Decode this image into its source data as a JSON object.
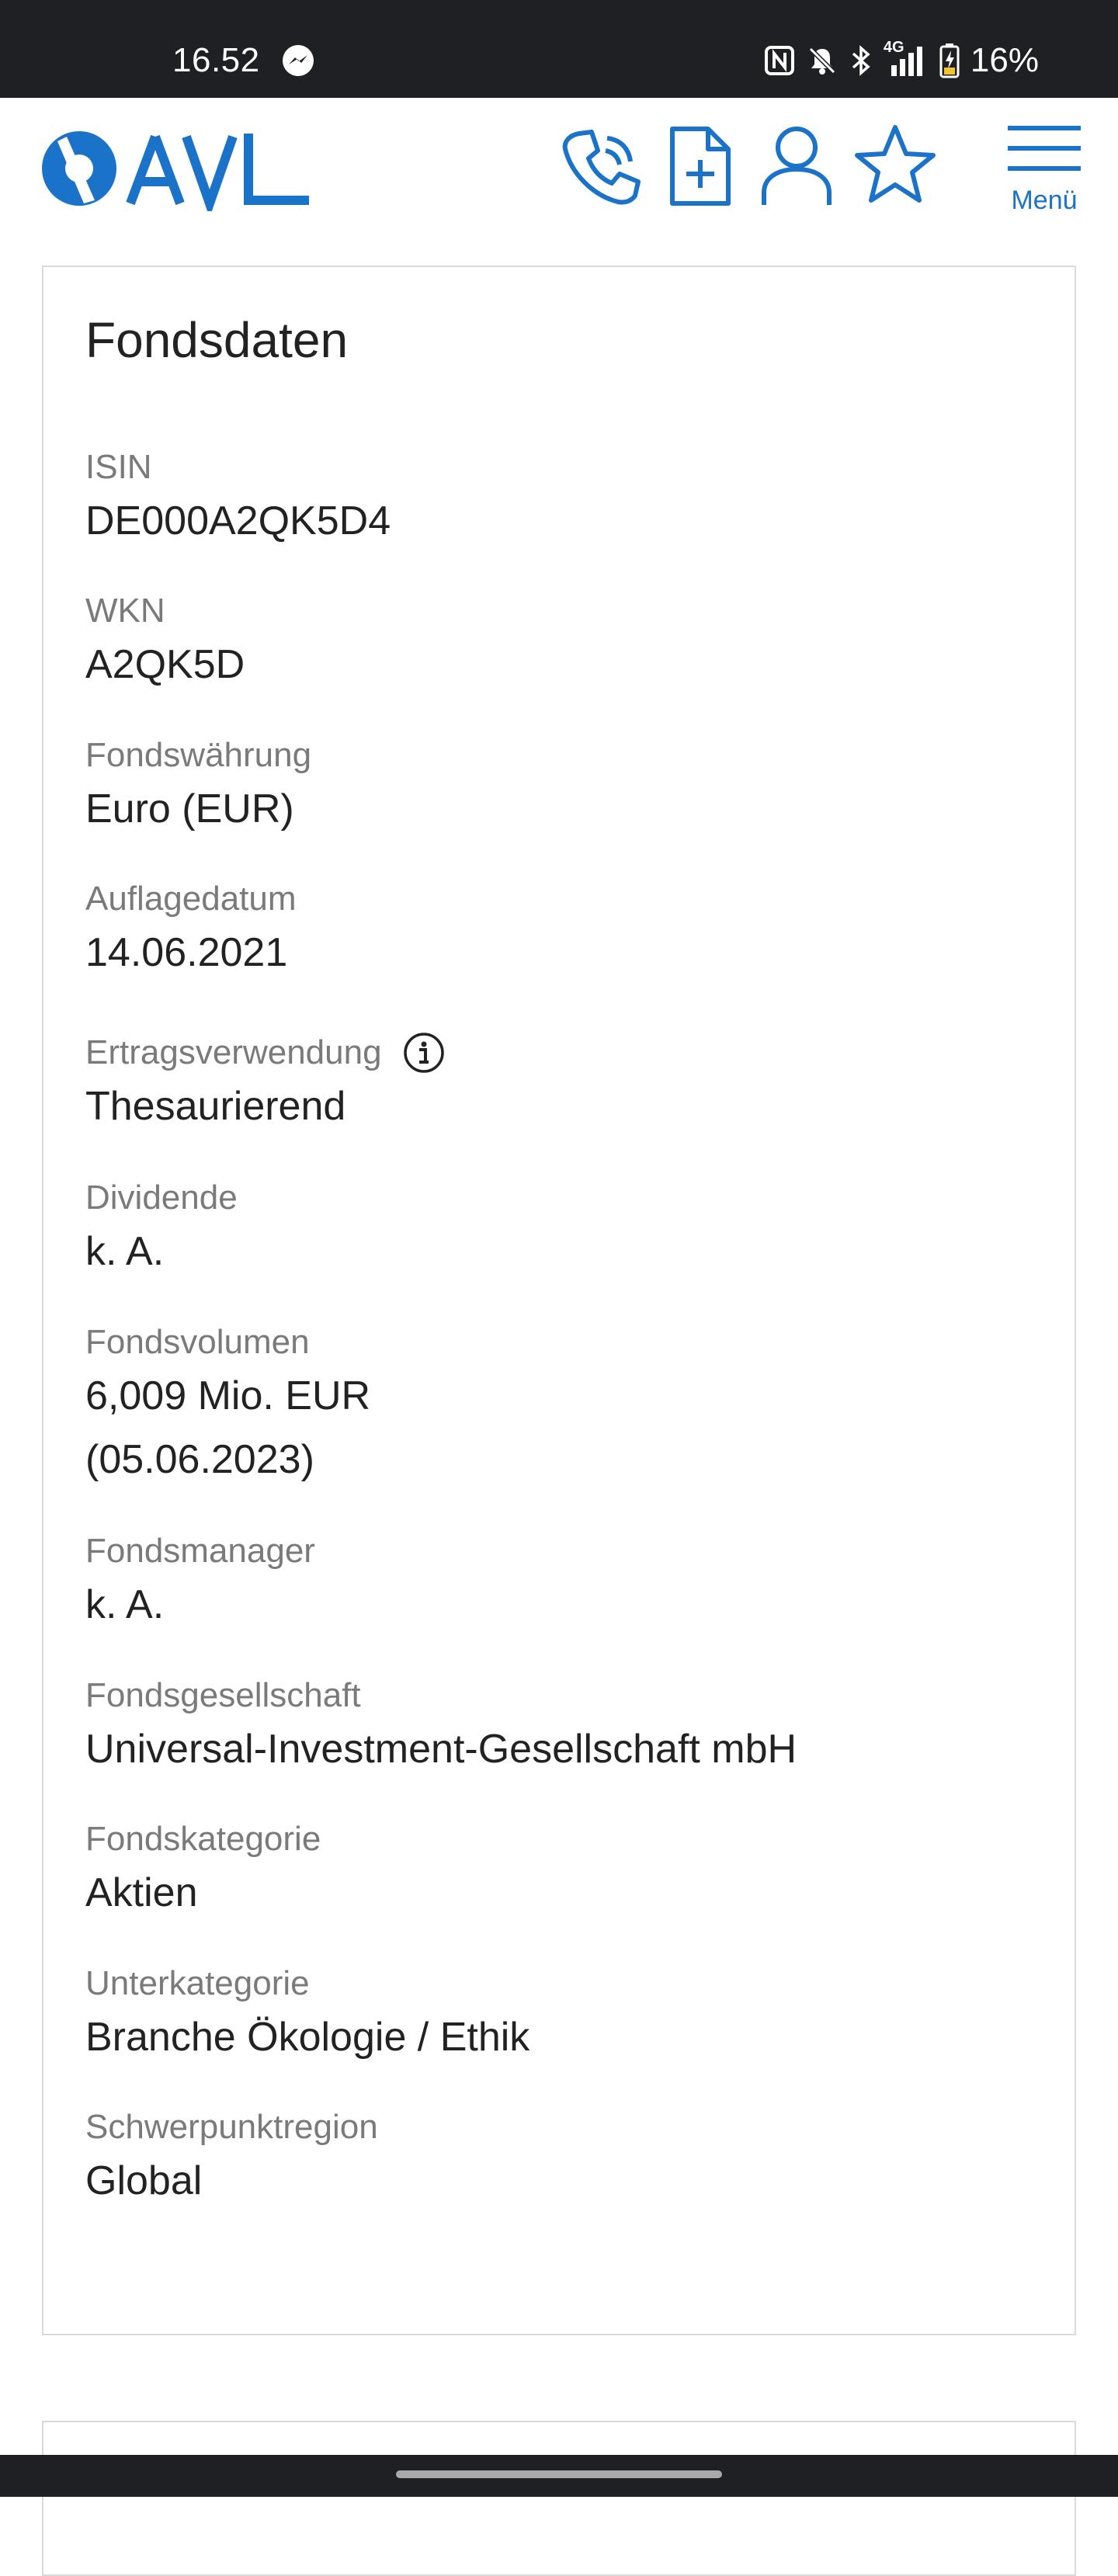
{
  "status_bar": {
    "time": "16.52",
    "network": "4G",
    "battery_percent": "16%"
  },
  "header": {
    "logo_text": "AVL",
    "menu_label": "Menü",
    "brand_color": "#1a73c8",
    "icons": [
      "phone-icon",
      "document-add-icon",
      "user-icon",
      "star-icon",
      "hamburger-menu-icon"
    ]
  },
  "fund_data": {
    "title": "Fondsdaten",
    "fields": [
      {
        "label": "ISIN",
        "value": "DE000A2QK5D4"
      },
      {
        "label": "WKN",
        "value": "A2QK5D"
      },
      {
        "label": "Fondswährung",
        "value": "Euro (EUR)"
      },
      {
        "label": "Auflagedatum",
        "value": "14.06.2021"
      },
      {
        "label": "Ertragsverwendung",
        "value": "Thesaurierend"
      },
      {
        "label": "Dividende",
        "value": "k. A."
      },
      {
        "label": "Fondsvolumen",
        "value": "6,009 Mio. EUR",
        "value2": "(05.06.2023)"
      },
      {
        "label": "Fondsmanager",
        "value": "k. A."
      },
      {
        "label": "Fondsgesellschaft",
        "value": "Universal-Investment-Gesellschaft mbH"
      },
      {
        "label": "Fondskategorie",
        "value": "Aktien"
      },
      {
        "label": "Unterkategorie",
        "value": "Branche Ökologie / Ethik"
      },
      {
        "label": "Schwerpunktregion",
        "value": "Global"
      }
    ]
  }
}
